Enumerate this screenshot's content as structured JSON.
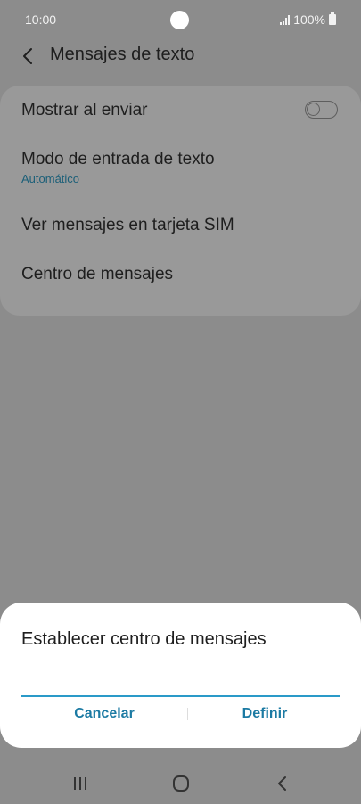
{
  "status_bar": {
    "time": "10:00",
    "battery": "100%",
    "icons": [
      "signal-icon",
      "battery-icon"
    ]
  },
  "header": {
    "title": "Mensajes de texto",
    "back_icon": "chevron-left-icon"
  },
  "settings": {
    "items": [
      {
        "label": "Mostrar al enviar",
        "toggle": false
      },
      {
        "label": "Modo de entrada de texto",
        "sublabel": "Automático"
      },
      {
        "label": "Ver mensajes en tarjeta SIM"
      },
      {
        "label": "Centro de mensajes"
      }
    ]
  },
  "dialog": {
    "title": "Establecer centro de mensajes",
    "input_value": "",
    "cancel_label": "Cancelar",
    "define_label": "Definir"
  },
  "nav_bar": {
    "icons": [
      "recent-apps-icon",
      "home-icon",
      "back-icon"
    ]
  },
  "colors": {
    "scrim": "#8c8c8c",
    "accent": "#1b7aa3",
    "input_underline": "#2a9ac8"
  }
}
